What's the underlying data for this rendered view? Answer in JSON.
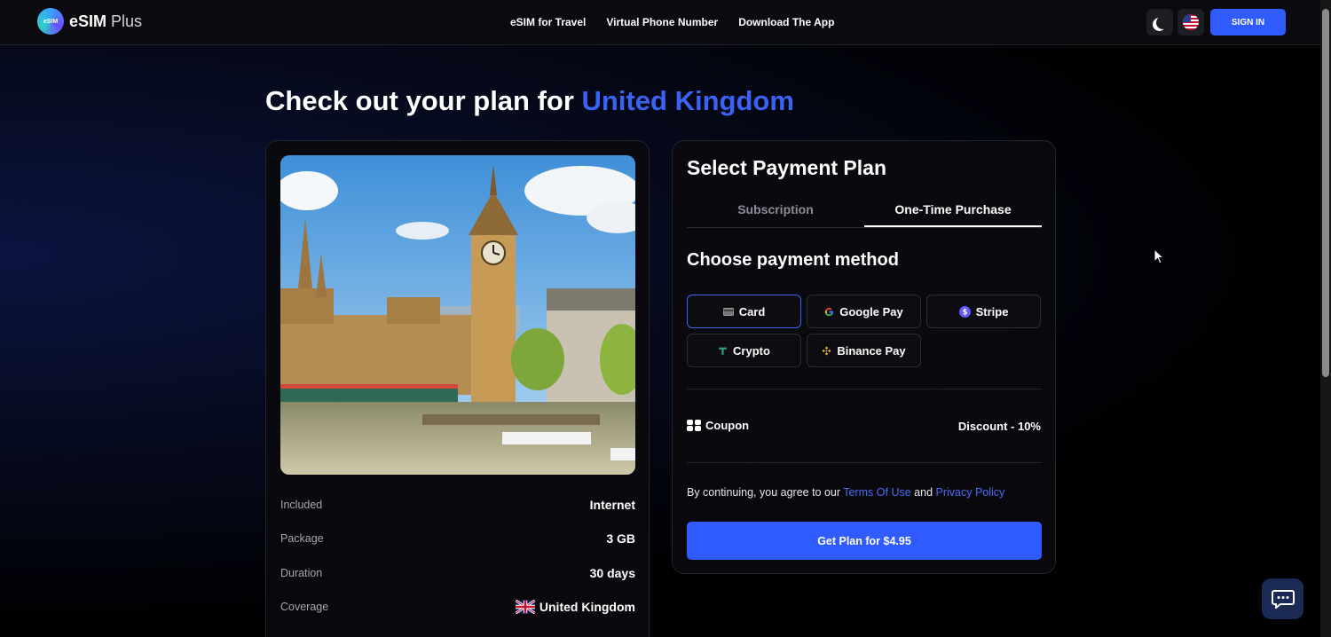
{
  "header": {
    "logo_brand": "eSIM",
    "logo_suffix": "Plus",
    "logo_mark_text": "eSIM",
    "nav": [
      {
        "label": "eSIM for Travel"
      },
      {
        "label": "Virtual Phone Number"
      },
      {
        "label": "Download The App"
      }
    ],
    "sign_in_label": "SIGN IN",
    "icons": {
      "theme": "moon-icon",
      "language": "us-flag-icon"
    }
  },
  "page": {
    "title_prefix": "Check out your plan for",
    "title_country": "United Kingdom"
  },
  "plan": {
    "rows": [
      {
        "label": "Included",
        "value": "Internet"
      },
      {
        "label": "Package",
        "value": "3 GB"
      },
      {
        "label": "Duration",
        "value": "30 days"
      },
      {
        "label": "Coverage",
        "value": "United Kingdom"
      }
    ]
  },
  "payment": {
    "heading": "Select Payment Plan",
    "tabs": [
      {
        "label": "Subscription",
        "active": false
      },
      {
        "label": "One-Time Purchase",
        "active": true
      }
    ],
    "method_heading": "Choose payment method",
    "methods": [
      {
        "label": "Card",
        "icon": "card-icon",
        "selected": true
      },
      {
        "label": "Google Pay",
        "icon": "google-icon",
        "selected": false
      },
      {
        "label": "Stripe",
        "icon": "stripe-icon",
        "selected": false
      },
      {
        "label": "Crypto",
        "icon": "tether-icon",
        "selected": false
      },
      {
        "label": "Binance Pay",
        "icon": "binance-icon",
        "selected": false
      }
    ],
    "coupon_label": "Coupon",
    "discount_label": "Discount - 10%",
    "terms_prefix": "By continuing, you agree to our",
    "terms_link": "Terms Of Use",
    "terms_and": "and",
    "privacy_link": "Privacy Policy",
    "cta_label": "Get Plan for $4.95"
  },
  "colors": {
    "accent": "#2f5bff",
    "highlight": "#3a63f5",
    "link": "#4a6cf7"
  }
}
